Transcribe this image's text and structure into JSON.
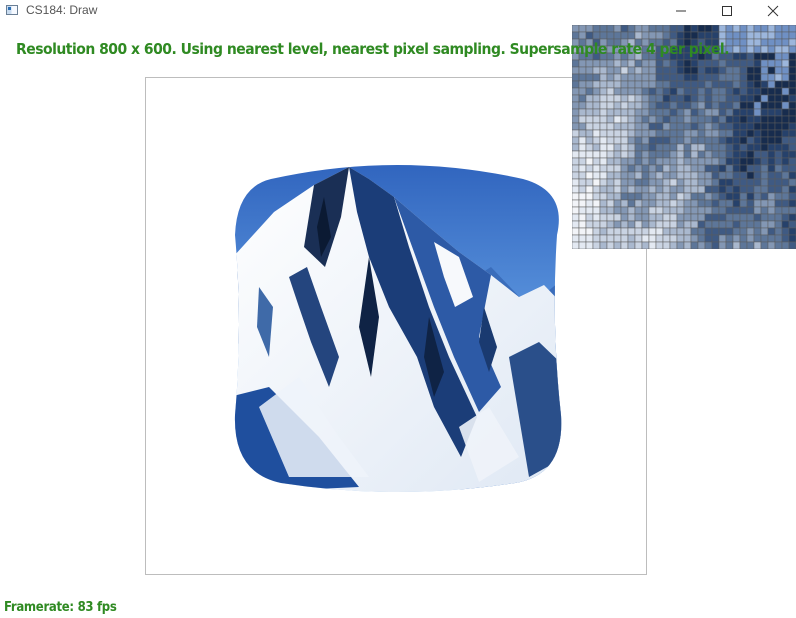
{
  "window": {
    "title": "CS184: Draw",
    "controls": {
      "minimize": "minimize-icon",
      "maximize": "maximize-icon",
      "close": "close-icon"
    }
  },
  "overlay": {
    "info": "Resolution 800 x 600. Using nearest level, nearest pixel sampling. Supersample rate 4 per pixel.",
    "framerate": "Framerate: 83 fps"
  },
  "colors": {
    "overlay_text": "#2f8a22",
    "sky": "#3c77cc",
    "snow": "#f4f6fa",
    "rock": "#1d3d72"
  }
}
